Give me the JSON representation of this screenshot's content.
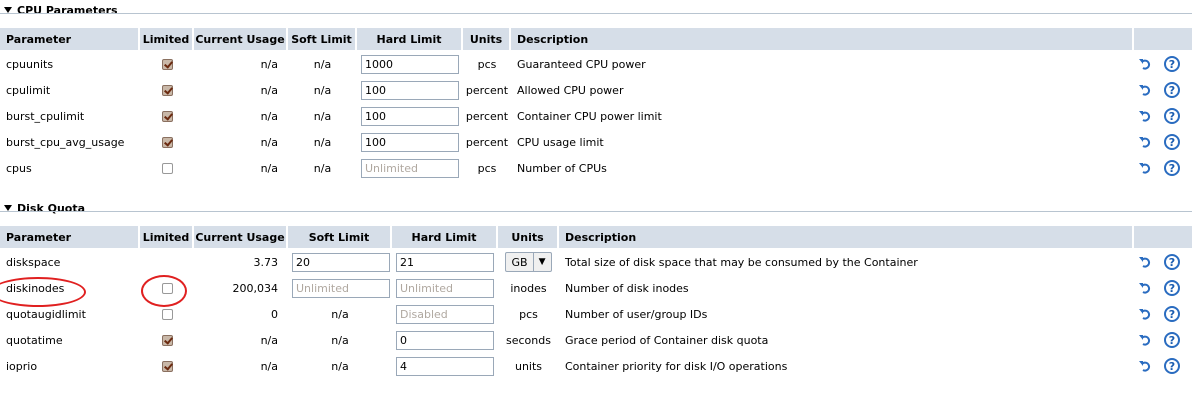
{
  "cpu": {
    "title": "CPU Parameters",
    "headers": {
      "parameter": "Parameter",
      "limited": "Limited",
      "current": "Current Usage",
      "soft": "Soft Limit",
      "hard": "Hard Limit",
      "units": "Units",
      "description": "Description"
    },
    "rows": [
      {
        "parameter": "cpuunits",
        "limited": true,
        "current": "n/a",
        "soft": "n/a",
        "hard_value": "1000",
        "hard_placeholder": "",
        "units": "pcs",
        "description": "Guaranteed CPU power"
      },
      {
        "parameter": "cpulimit",
        "limited": true,
        "current": "n/a",
        "soft": "n/a",
        "hard_value": "100",
        "hard_placeholder": "",
        "units": "percent",
        "description": "Allowed CPU power"
      },
      {
        "parameter": "burst_cpulimit",
        "limited": true,
        "current": "n/a",
        "soft": "n/a",
        "hard_value": "100",
        "hard_placeholder": "",
        "units": "percent",
        "description": "Container CPU power limit"
      },
      {
        "parameter": "burst_cpu_avg_usage",
        "limited": true,
        "current": "n/a",
        "soft": "n/a",
        "hard_value": "100",
        "hard_placeholder": "",
        "units": "percent",
        "description": "CPU usage limit"
      },
      {
        "parameter": "cpus",
        "limited": false,
        "current": "n/a",
        "soft": "n/a",
        "hard_value": "",
        "hard_placeholder": "Unlimited",
        "units": "pcs",
        "description": "Number of CPUs"
      }
    ]
  },
  "disk": {
    "title": "Disk Quota",
    "headers": {
      "parameter": "Parameter",
      "limited": "Limited",
      "current": "Current Usage",
      "soft": "Soft Limit",
      "hard": "Hard Limit",
      "units": "Units",
      "description": "Description"
    },
    "rows": [
      {
        "parameter": "diskspace",
        "limited": null,
        "current": "3.73",
        "soft_value": "20",
        "soft_placeholder": "",
        "hard_value": "21",
        "hard_placeholder": "",
        "units": "GB",
        "units_select": true,
        "description": "Total size of disk space that may be consumed by the Container"
      },
      {
        "parameter": "diskinodes",
        "limited": false,
        "current": "200,034",
        "soft_value": "",
        "soft_placeholder": "Unlimited",
        "hard_value": "",
        "hard_placeholder": "Unlimited",
        "units": "inodes",
        "description": "Number of disk inodes"
      },
      {
        "parameter": "quotaugidlimit",
        "limited": false,
        "current": "0",
        "soft": "n/a",
        "hard_value": "",
        "hard_placeholder": "Disabled",
        "units": "pcs",
        "description": "Number of user/group IDs"
      },
      {
        "parameter": "quotatime",
        "limited": true,
        "current": "n/a",
        "soft": "n/a",
        "hard_value": "0",
        "hard_placeholder": "",
        "units": "seconds",
        "description": "Grace period of Container disk quota"
      },
      {
        "parameter": "ioprio",
        "limited": true,
        "current": "n/a",
        "soft": "n/a",
        "hard_value": "4",
        "hard_placeholder": "",
        "units": "units",
        "description": "Container priority for disk I/O operations"
      }
    ]
  },
  "colors": {
    "header_bg": "#d6dee8",
    "accent": "#2a6cc0",
    "annotation": "#e02020"
  },
  "icons": {
    "undo": "undo-icon",
    "help": "help-icon"
  },
  "help_glyph": "?"
}
